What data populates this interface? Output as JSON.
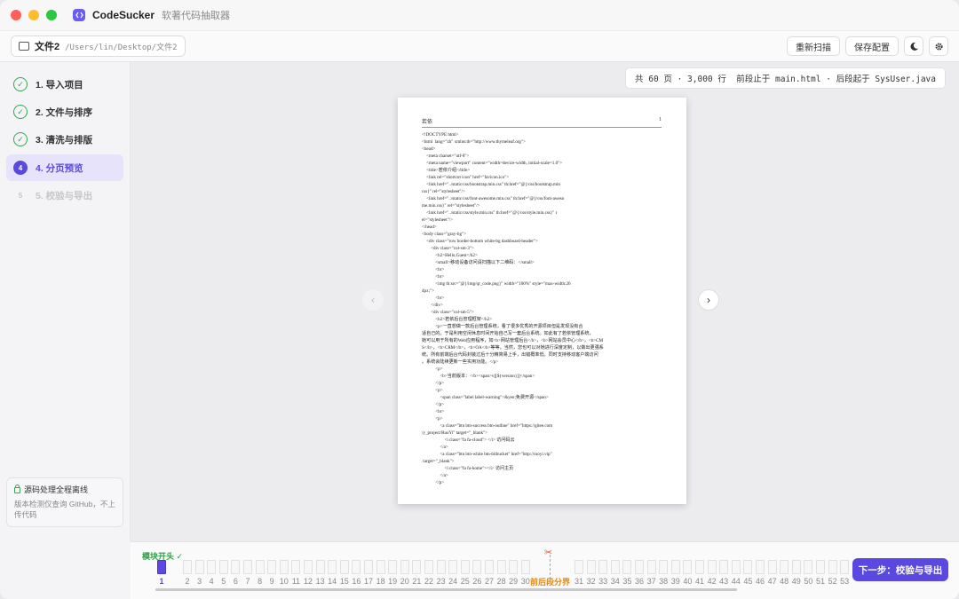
{
  "app": {
    "name": "CodeSucker",
    "subtitle": "软著代码抽取器"
  },
  "toolbar": {
    "project_name": "文件2",
    "project_path": "/Users/lin/Desktop/文件2",
    "rescan_label": "重新扫描",
    "save_label": "保存配置",
    "theme_icon": "moon-icon",
    "settings_icon": "gear-icon"
  },
  "sidebar": {
    "steps": [
      {
        "label": "1. 导入项目",
        "state": "done"
      },
      {
        "label": "2. 文件与排序",
        "state": "done"
      },
      {
        "label": "3. 清洗与排版",
        "state": "done"
      },
      {
        "label": "4. 分页预览",
        "state": "active",
        "num": "4"
      },
      {
        "label": "5. 校验与导出",
        "state": "disabled",
        "num": "5"
      }
    ],
    "privacy_title": "源码处理全程离线",
    "privacy_desc": "版本检测仅查询 GitHub，不上传代码"
  },
  "stats": {
    "text": "共 60 页 · 3,000 行  前段止于 main.html · 后段起于 SysUser.java"
  },
  "page": {
    "header_left": "若依",
    "header_right": "1",
    "lines": [
      "<!DOCTYPE html>",
      "<html  lang=\"zh\" xmlns:th=\"http://www.thymeleaf.org\">",
      "<head>",
      "    <meta charset=\"utf-8\">",
      "    <meta name=\"viewport\" content=\"width=device-width, initial-scale=1.0\">",
      "    <title>若依介绍</title>",
      "    <link rel=\"shortcut icon\" href=\"favicon.ico\">",
      "    <link href=\"../static/css/bootstrap.min.css\" th:href=\"@{/css/bootstrap.min",
      "css}\" rel=\"stylesheet\"/>",
      "    <link href=\"../static/css/font-awesome.min.css\" th:href=\"@{/css/font-aweso",
      "me.min.css}\" rel=\"stylesheet\"/>",
      "    <link href=\"../static/css/style.min.css\" th:href=\"@{/css/style.min.css}\" r",
      "el=\"stylesheet\"/>",
      "</head>",
      "<body class=\"gray-bg\">",
      "    <div class=\"row border-bottom white-bg dashboard-header\">",
      "        <div class=\"col-sm-3\">",
      "            <h2>Hello,Guest</h2>",
      "            <small>移动设备访问请扫描以下二维码：</small>",
      "            <br>",
      "            <br>",
      "            <img th:src=\"@{/img/qr_code.png}\" width=\"100%\" style=\"max-width:26",
      "4px;\">",
      "            <br>",
      "        </div>",
      "        <div class=\"col-sm-5\">",
      "            <h2>若依后台管理框架</h2>",
      "            <p>一直想做一款后台管理系统，看了很多优秀的开源项目但是发现没有合",
      "适自己的。于是利用空闲休息时间开始自己写一套后台系统。如此有了若依管理系统，",
      "她可以用于所有的Web应用程序，如<b>网站管理后台</b>，<b>网站会员中心</b>，<b>CM",
      "S</b>，<b>CRM</b>，<b>OA</b>等等，当然，您也可以对她进行深度定制，以做出更强系",
      "统。所有前端后台代码封装过后十分精简易上手，出错概率低。同时支持移动客户端访问",
      "。系统会陆续更新一些实用功能。</p>",
      "            <p>",
      "                <b>当前版本：</b><span>v[[${version}]]</span>",
      "            </p>",
      "            <p>",
      "                <span class=\"label label-warning\">&yen;免费开源</span>",
      "            </p>",
      "            <br>",
      "            <p>",
      "                <a class=\"btn btn-success btn-outline\" href=\"https://gitee.com",
      "/y_project/RuoYi\" target=\"_blank\">",
      "                    <i class=\"fa fa-cloud\"> </i> 访问码云",
      "                </a>",
      "                <a class=\"btn btn-white btn-bitbucket\" href=\"http://ruoyi.vip\"",
      " target=\"_blank\">",
      "                    <i class=\"fa fa-home\"></i> 访问主页",
      "                </a>",
      "            </p>"
    ]
  },
  "timeline": {
    "module_start_label": "模块开头 ✓",
    "split_label": "前后段分界",
    "selected_page": 1,
    "front_pages": [
      "1",
      "2",
      "3",
      "4",
      "5",
      "6",
      "7",
      "8",
      "9",
      "10",
      "11",
      "12",
      "13",
      "14",
      "15",
      "16",
      "17",
      "18",
      "19",
      "20",
      "21",
      "22",
      "23",
      "24",
      "25",
      "26",
      "27",
      "28",
      "29",
      "30"
    ],
    "back_pages": [
      "31",
      "32",
      "33",
      "34",
      "35",
      "36",
      "37",
      "38",
      "39",
      "40",
      "41",
      "42",
      "43",
      "44",
      "45",
      "46",
      "47",
      "48",
      "49",
      "50",
      "51",
      "52",
      "53"
    ]
  },
  "next_button_label": "下一步：校验与导出",
  "colors": {
    "accent": "#5a48e0",
    "success": "#34a853",
    "split": "#e08a10"
  }
}
